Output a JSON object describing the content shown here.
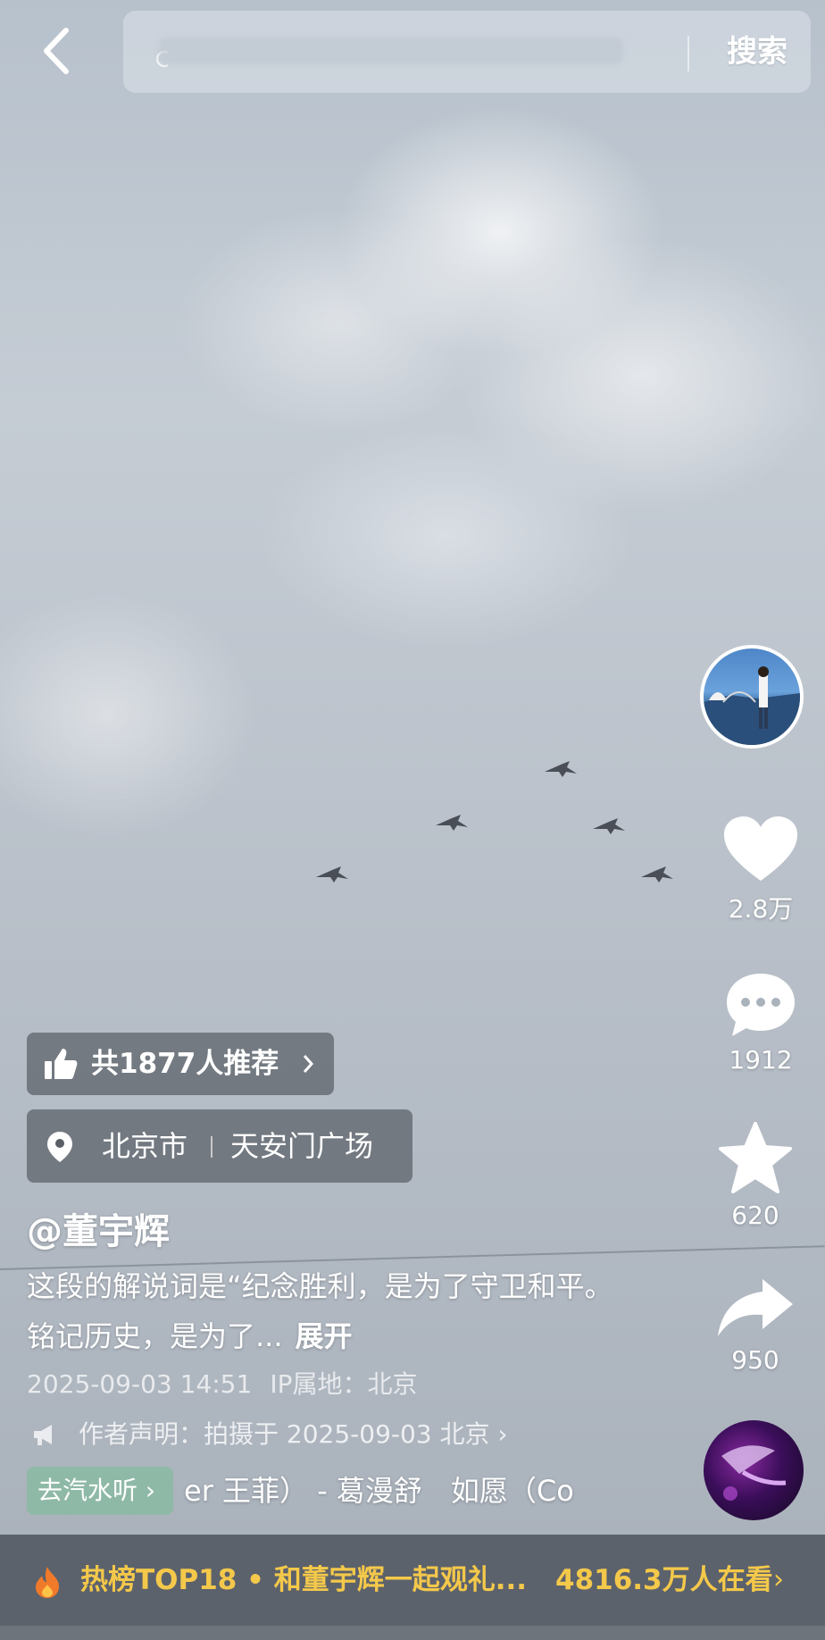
{
  "search": {
    "button_label": "搜索"
  },
  "recommend": {
    "label": "共1877人推荐"
  },
  "location": {
    "city": "北京市",
    "place": "天安门广场"
  },
  "post": {
    "author": "@董宇辉",
    "description": "这段的解说词是“纪念胜利，是为了守卫和平。铭记历史，是为了...",
    "expand_label": "展开",
    "datetime": "2025-09-03 14:51",
    "ip_location": "IP属地：北京",
    "author_statement": "作者声明：拍摄于 2025-09-03 北京"
  },
  "music": {
    "tag_label": "去汽水听",
    "song": "er 王菲） - 葛漫舒　如愿（Co"
  },
  "actions": {
    "likes": "2.8万",
    "comments": "1912",
    "favorites": "620",
    "shares": "950"
  },
  "hot": {
    "title": "热榜TOP18 • 和董宇辉一起观礼...",
    "viewers": "4816.3万人在看"
  },
  "colors": {
    "hot_text": "#f4c84a",
    "music_tag": "#78be96"
  },
  "icons": [
    "back-arrow-icon",
    "thumbs-up-icon",
    "location-pin-icon",
    "heart-icon",
    "comment-icon",
    "star-icon",
    "share-icon",
    "megaphone-icon",
    "flame-icon"
  ]
}
